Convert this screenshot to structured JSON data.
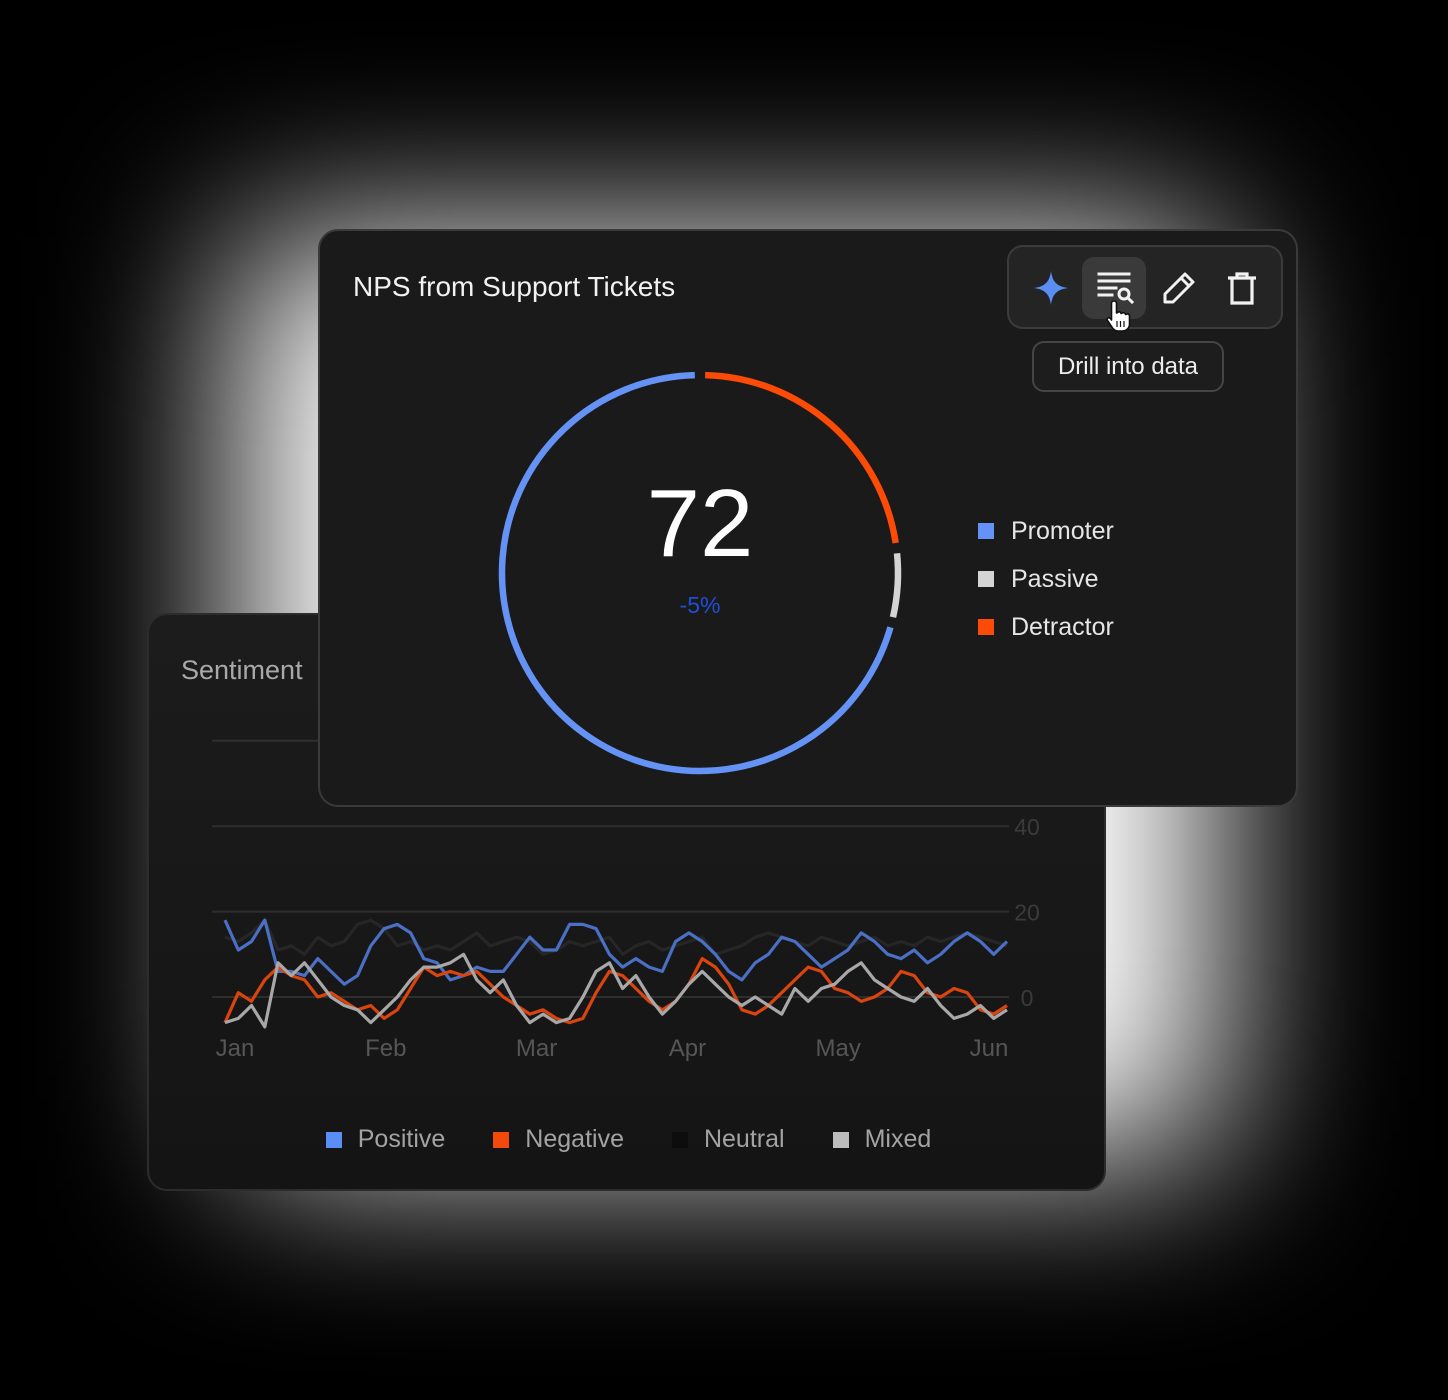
{
  "colors": {
    "positive": "#5b8ef5",
    "negative": "#f04a0d",
    "neutral": "#0d0d0d",
    "mixed": "#bdbdbd",
    "promoter": "#6593f5",
    "passive": "#d4d4d4",
    "detractor": "#fc4a07",
    "delta": "#1f4fd6"
  },
  "sentiment_card": {
    "title": "Sentiment",
    "legend": [
      {
        "label": "Positive",
        "color": "#5b8ef5"
      },
      {
        "label": "Negative",
        "color": "#f04a0d"
      },
      {
        "label": "Neutral",
        "color": "#0d0d0d"
      },
      {
        "label": "Mixed",
        "color": "#bdbdbd"
      }
    ]
  },
  "nps_card": {
    "title": "NPS from Support Tickets",
    "score": "72",
    "delta": "-5%",
    "legend": [
      {
        "label": "Promoter",
        "color": "#6593f5"
      },
      {
        "label": "Passive",
        "color": "#d4d4d4"
      },
      {
        "label": "Detractor",
        "color": "#fc4a07"
      }
    ],
    "toolbar": {
      "icons": [
        "sparkle-icon",
        "drill-into-data-icon",
        "edit-pencil-icon",
        "trash-icon"
      ],
      "tooltip": "Drill into data"
    }
  },
  "chart_data": [
    {
      "type": "line",
      "title": "Sentiment",
      "x": [
        "Jan",
        "Feb",
        "Mar",
        "Apr",
        "May",
        "Jun"
      ],
      "y_ticks": [
        0,
        20,
        40
      ],
      "ylim": [
        -8,
        60
      ],
      "series": [
        {
          "name": "Positive",
          "values": [
            18,
            11,
            13,
            18,
            6,
            6,
            5,
            9,
            6,
            3,
            5,
            12,
            16,
            17,
            15,
            9,
            8,
            4,
            5,
            7,
            6,
            6,
            10,
            14,
            11,
            11,
            17,
            17,
            16,
            10,
            7,
            9,
            7,
            6,
            13,
            15,
            13,
            10,
            6,
            4,
            8,
            10,
            14,
            13,
            10,
            7,
            9,
            11,
            15,
            13,
            10,
            9,
            11,
            8,
            10,
            13,
            15,
            13,
            10,
            13
          ]
        },
        {
          "name": "Negative",
          "values": [
            -6,
            1,
            -1,
            4,
            7,
            5,
            4,
            0,
            1,
            -1,
            -3,
            -2,
            -5,
            -3,
            2,
            7,
            5,
            6,
            5,
            6,
            3,
            0,
            -2,
            -4,
            -3,
            -5,
            -6,
            -5,
            1,
            6,
            5,
            2,
            -1,
            -3,
            -1,
            3,
            9,
            7,
            3,
            -3,
            -4,
            -2,
            1,
            4,
            7,
            6,
            2,
            1,
            -1,
            0,
            2,
            6,
            5,
            1,
            0,
            2,
            1,
            -3,
            -4,
            -2
          ]
        },
        {
          "name": "Neutral",
          "values": [
            14,
            13,
            15,
            18,
            11,
            12,
            10,
            14,
            12,
            13,
            17,
            18,
            16,
            12,
            13,
            11,
            12,
            11,
            13,
            15,
            12,
            13,
            14,
            13,
            10,
            11,
            13,
            12,
            13,
            14,
            10,
            12,
            13,
            11,
            12,
            13,
            14,
            10,
            11,
            12,
            14,
            15,
            14,
            13,
            12,
            14,
            13,
            12,
            13,
            14,
            12,
            13,
            12,
            14,
            13,
            14,
            15,
            14,
            13,
            12
          ]
        },
        {
          "name": "Mixed",
          "values": [
            -6,
            -5,
            -2,
            -7,
            8,
            5,
            8,
            4,
            0,
            -2,
            -3,
            -6,
            -3,
            0,
            4,
            7,
            7,
            8,
            10,
            4,
            1,
            4,
            -2,
            -6,
            -4,
            -6,
            -5,
            0,
            6,
            8,
            2,
            5,
            0,
            -4,
            -1,
            3,
            6,
            3,
            0,
            -2,
            0,
            -2,
            -4,
            2,
            -1,
            2,
            3,
            6,
            8,
            4,
            2,
            0,
            -1,
            2,
            -2,
            -5,
            -4,
            -2,
            -5,
            -3
          ]
        }
      ]
    },
    {
      "type": "pie",
      "title": "NPS from Support Tickets",
      "categories": [
        "Promoter",
        "Passive",
        "Detractor"
      ],
      "values": [
        71,
        6,
        23
      ]
    }
  ]
}
